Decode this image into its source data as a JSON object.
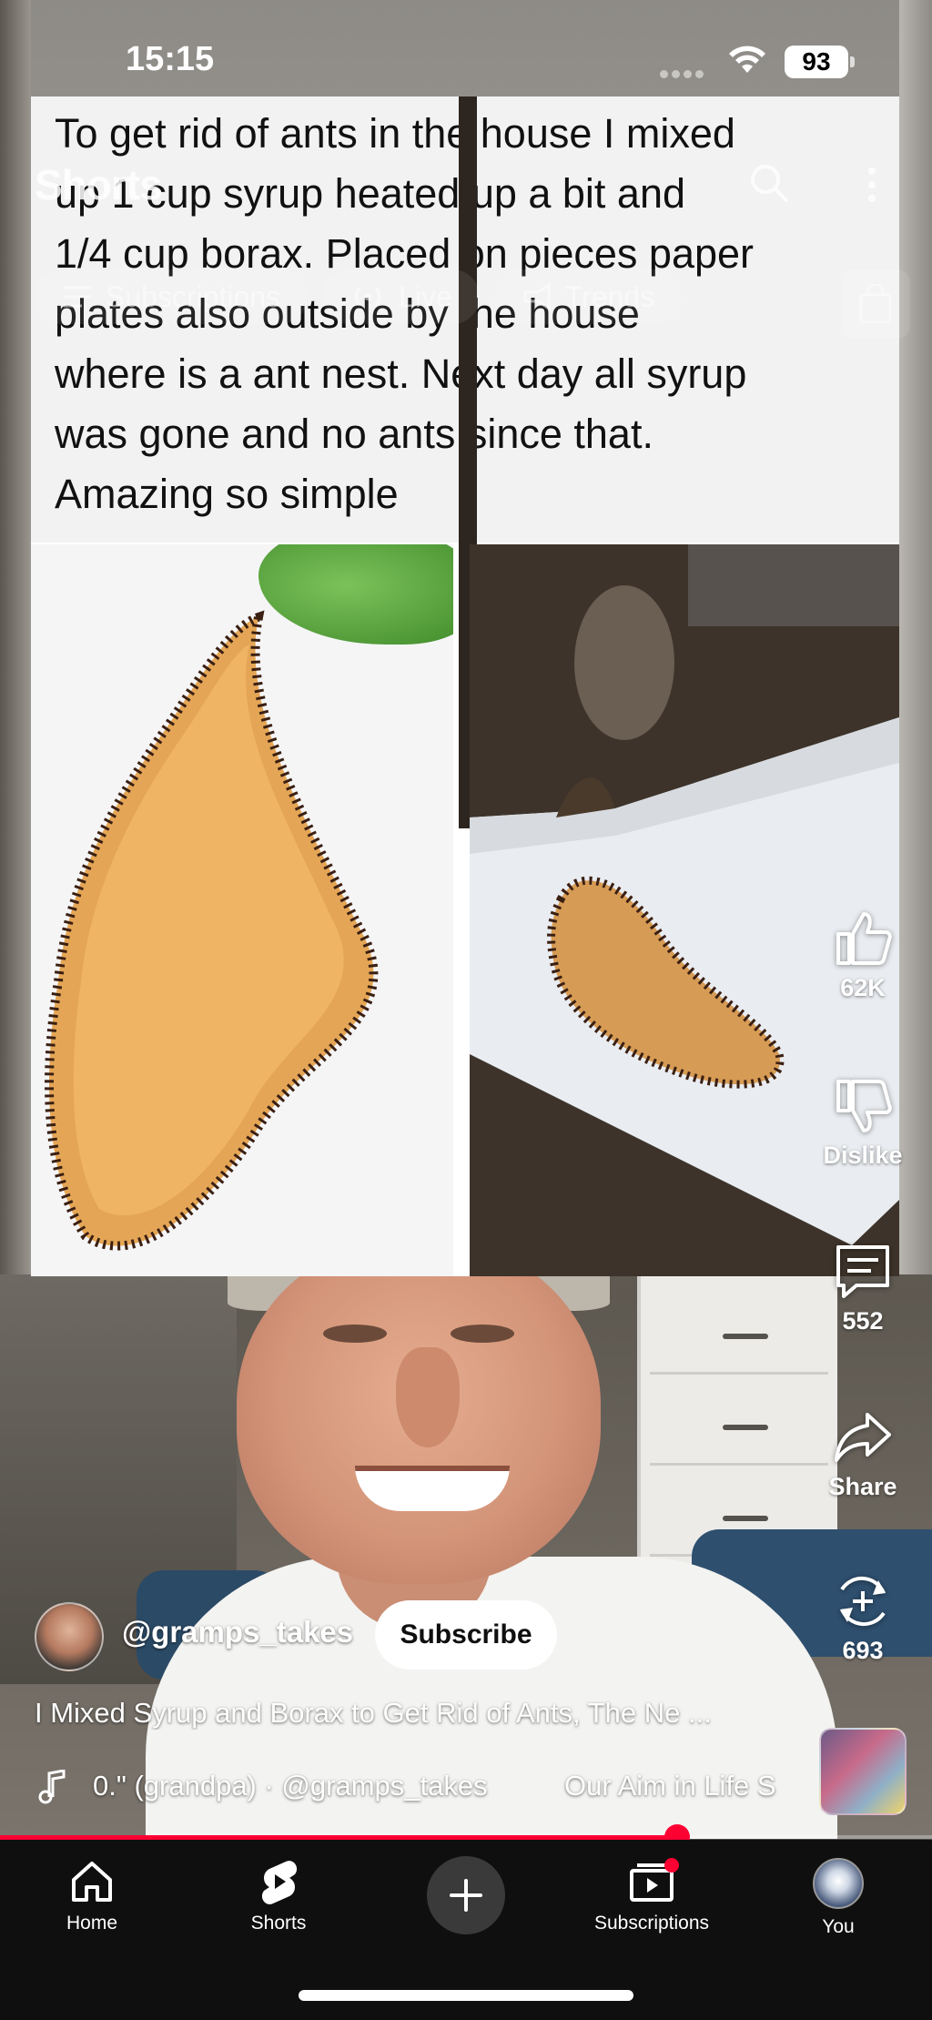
{
  "status_bar": {
    "time": "15:15",
    "battery": "93"
  },
  "header": {
    "title": "Shorts",
    "chips": [
      {
        "label": "Subscriptions",
        "icon": "list-icon"
      },
      {
        "label": "Live",
        "icon": "live-icon"
      },
      {
        "label": "Trends",
        "icon": "trending-icon"
      }
    ]
  },
  "card": {
    "text_lines": [
      "To get rid of ants in the house I mixed",
      "up 1 cup syrup heated up a bit and",
      "1/4 cup borax. Placed on pieces paper",
      "plates also outside by the house",
      "where is a ant nest. Next day all syrup",
      "was gone and no ants since that.",
      "Amazing so simple"
    ]
  },
  "actions": {
    "like": "62K",
    "dislike": "Dislike",
    "comments": "552",
    "share": "Share",
    "remix": "693"
  },
  "channel": {
    "handle": "@gramps_takes",
    "subscribe_label": "Subscribe"
  },
  "video": {
    "title": "I Mixed Syrup and Borax to Get Rid of Ants, The Ne ...",
    "sound": "0.\" (grandpa) · @gramps_takes",
    "sound_extra": "Our Aim in Life S",
    "progress": 0.727
  },
  "nav": {
    "home": "Home",
    "shorts": "Shorts",
    "subscriptions": "Subscriptions",
    "you": "You"
  },
  "colors": {
    "accent": "#ff0033",
    "nav_bg": "#0f0f0f"
  }
}
